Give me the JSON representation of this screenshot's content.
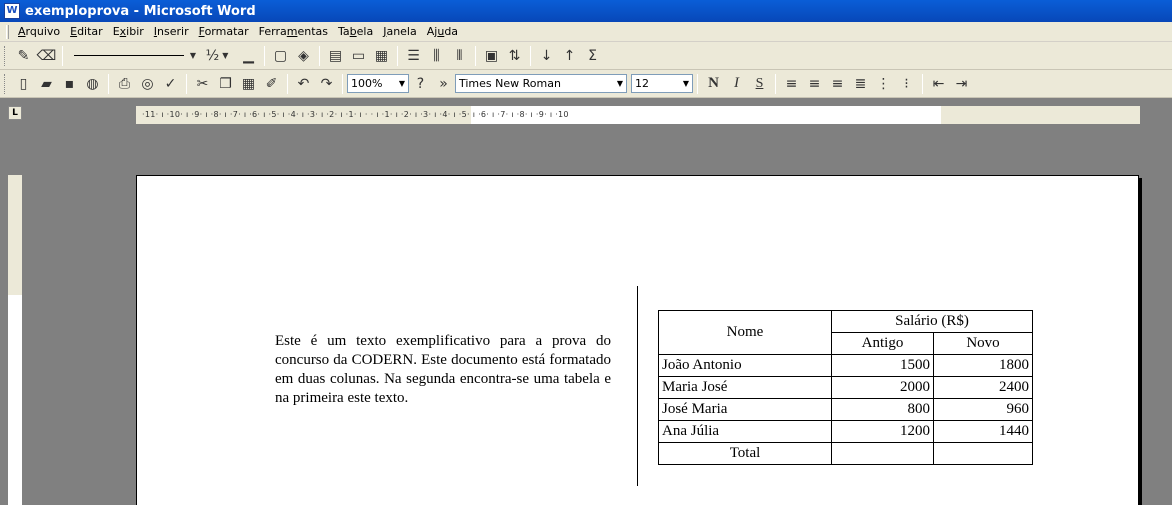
{
  "window": {
    "title": "exemploprova - Microsoft Word",
    "app_icon": "W"
  },
  "menu": [
    {
      "pre": "",
      "key": "A",
      "post": "rquivo"
    },
    {
      "pre": "",
      "key": "E",
      "post": "ditar"
    },
    {
      "pre": "E",
      "key": "x",
      "post": "ibir"
    },
    {
      "pre": "",
      "key": "I",
      "post": "nserir"
    },
    {
      "pre": "",
      "key": "F",
      "post": "ormatar"
    },
    {
      "pre": "Ferra",
      "key": "m",
      "post": "entas"
    },
    {
      "pre": "Ta",
      "key": "b",
      "post": "ela"
    },
    {
      "pre": "",
      "key": "J",
      "post": "anela"
    },
    {
      "pre": "Aj",
      "key": "u",
      "post": "da"
    }
  ],
  "toolbar1": {
    "line_weight": "½",
    "sigma": "Σ"
  },
  "toolbar2": {
    "zoom": "100%",
    "font": "Times New Roman",
    "size": "12",
    "bold": "N",
    "italic": "I",
    "underline": "S"
  },
  "ruler": {
    "tab_selector": "L",
    "marks": "·11· ı ·10· ı ·9· ı ·8· ı ·7· ı ·6· ı ·5· ı ·4· ı ·3· ı ·2· ı ·1· ı ·    · ı ·1· ı ·2· ı ·3· ı ·4· ı ·5· ı ·6· ı ·7· ı ·8· ı ·9· ı ·10"
  },
  "document": {
    "paragraph": "Este é um texto exemplificativo para a prova do concurso da CODERN. Este documento está formatado em duas colunas. Na segunda encontra-se uma tabela e na primeira este texto.",
    "table": {
      "header_nome": "Nome",
      "header_salario": "Salário (R$)",
      "header_antigo": "Antigo",
      "header_novo": "Novo",
      "rows": [
        {
          "nome": "João Antonio",
          "antigo": "1500",
          "novo": "1800"
        },
        {
          "nome": "Maria José",
          "antigo": "2000",
          "novo": "2400"
        },
        {
          "nome": "José Maria",
          "antigo": "800",
          "novo": "960"
        },
        {
          "nome": "Ana Júlia",
          "antigo": "1200",
          "novo": "1440"
        }
      ],
      "total_label": "Total"
    }
  }
}
